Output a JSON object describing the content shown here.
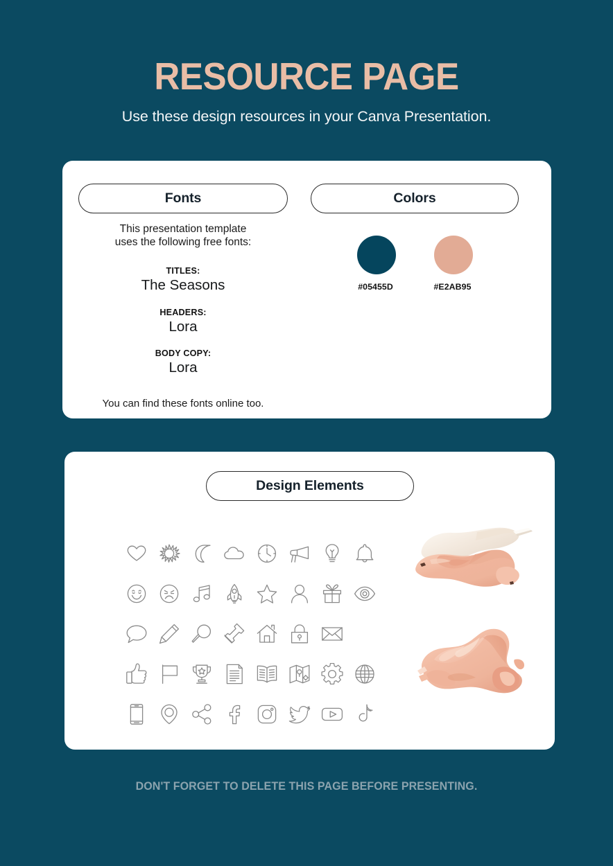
{
  "theme": {
    "background": "#0b4a61",
    "card_background": "#ffffff",
    "title_color": "#e9bda6",
    "subtitle_color": "#f4f6f7",
    "footer_color": "#8ba3ae",
    "icon_stroke": "#8a8a8a"
  },
  "header": {
    "title": "RESOURCE PAGE",
    "subtitle": "Use these design resources in your Canva Presentation."
  },
  "fonts_card": {
    "pill_label": "Fonts",
    "intro": "This presentation template\nuses the following free fonts:",
    "intro_line_1": "This presentation template",
    "intro_line_2": "uses the following free fonts:",
    "groups": [
      {
        "label": "TITLES:",
        "value": "The Seasons"
      },
      {
        "label": "HEADERS:",
        "value": "Lora"
      },
      {
        "label": "BODY COPY:",
        "value": "Lora"
      }
    ],
    "footnote": "You can find these fonts online too."
  },
  "colors_card": {
    "pill_label": "Colors",
    "swatches": [
      {
        "hex": "#05455D",
        "label": "#05455D"
      },
      {
        "hex": "#E2AB95",
        "label": "#E2AB95"
      }
    ]
  },
  "design_elements_card": {
    "pill_label": "Design Elements",
    "icon_rows": [
      [
        {
          "name": "heart-icon"
        },
        {
          "name": "sun-icon"
        },
        {
          "name": "moon-icon"
        },
        {
          "name": "cloud-icon"
        },
        {
          "name": "clock-icon"
        },
        {
          "name": "megaphone-icon"
        },
        {
          "name": "lightbulb-icon"
        },
        {
          "name": "bell-icon"
        }
      ],
      [
        {
          "name": "smiley-face-icon"
        },
        {
          "name": "sad-face-icon"
        },
        {
          "name": "music-note-icon"
        },
        {
          "name": "rocket-icon"
        },
        {
          "name": "star-icon"
        },
        {
          "name": "person-icon"
        },
        {
          "name": "gift-icon"
        },
        {
          "name": "eye-icon"
        }
      ],
      [
        {
          "name": "speech-bubble-icon"
        },
        {
          "name": "pencil-icon"
        },
        {
          "name": "magnifier-icon"
        },
        {
          "name": "pushpin-icon"
        },
        {
          "name": "home-icon"
        },
        {
          "name": "lock-icon"
        },
        {
          "name": "envelope-icon"
        }
      ],
      [
        {
          "name": "thumbs-up-icon"
        },
        {
          "name": "flag-icon"
        },
        {
          "name": "trophy-icon"
        },
        {
          "name": "document-icon"
        },
        {
          "name": "book-icon"
        },
        {
          "name": "map-icon"
        },
        {
          "name": "gear-icon"
        },
        {
          "name": "globe-icon"
        }
      ],
      [
        {
          "name": "phone-icon"
        },
        {
          "name": "location-pin-icon"
        },
        {
          "name": "share-icon"
        },
        {
          "name": "facebook-icon"
        },
        {
          "name": "instagram-icon"
        },
        {
          "name": "twitter-icon"
        },
        {
          "name": "youtube-icon"
        },
        {
          "name": "tiktok-icon"
        }
      ]
    ],
    "photos": [
      {
        "name": "silk-fabric-photo-top"
      },
      {
        "name": "silk-fabric-photo-bottom"
      }
    ]
  },
  "footer": {
    "note": "DON'T FORGET TO DELETE THIS PAGE BEFORE PRESENTING."
  }
}
